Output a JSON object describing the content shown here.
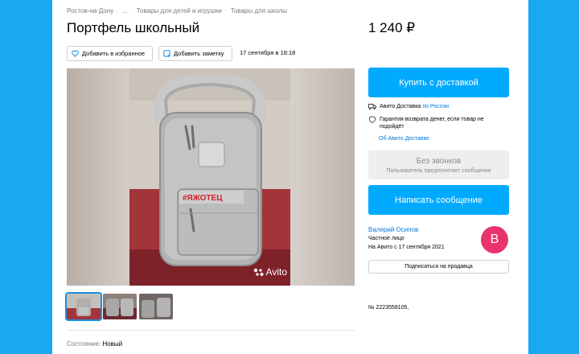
{
  "breadcrumb": [
    "Ростов-на-Дону",
    "...",
    "Товары для детей и игрушки",
    "Товары для школы"
  ],
  "title": "Портфель школьный",
  "price": "1 240 ₽",
  "actions": {
    "favorite": "Добавить в избранное",
    "note": "Добавить заметку"
  },
  "date": "17 сентября в 18:18",
  "photo": {
    "tag_text": "#ЯЖОТЕЦ",
    "watermark": "Avito"
  },
  "condition": {
    "label": "Состояние:",
    "value": "Новый"
  },
  "buy_button": "Купить с доставкой",
  "delivery": {
    "text": "Авито Доставка",
    "link": "по России"
  },
  "guarantee": "Гарантия возврата денег, если товар не подойдёт",
  "about_link": "Об Авито Доставке",
  "no_calls": {
    "title": "Без звонков",
    "subtitle": "Пользователь предпочитает сообщения"
  },
  "message_button": "Написать сообщение",
  "seller": {
    "name": "Валерий Осипов",
    "type": "Частное лицо",
    "since": "На Авито с 17 сентября 2021",
    "avatar_letter": "В",
    "avatar_color": "#e8336b"
  },
  "subscribe_button": "Подписаться на продавца",
  "ad_number": "№ 2223558105,",
  "colors": {
    "accent": "#00aaff",
    "link": "#0077dd",
    "frame": "#19a9ee"
  }
}
